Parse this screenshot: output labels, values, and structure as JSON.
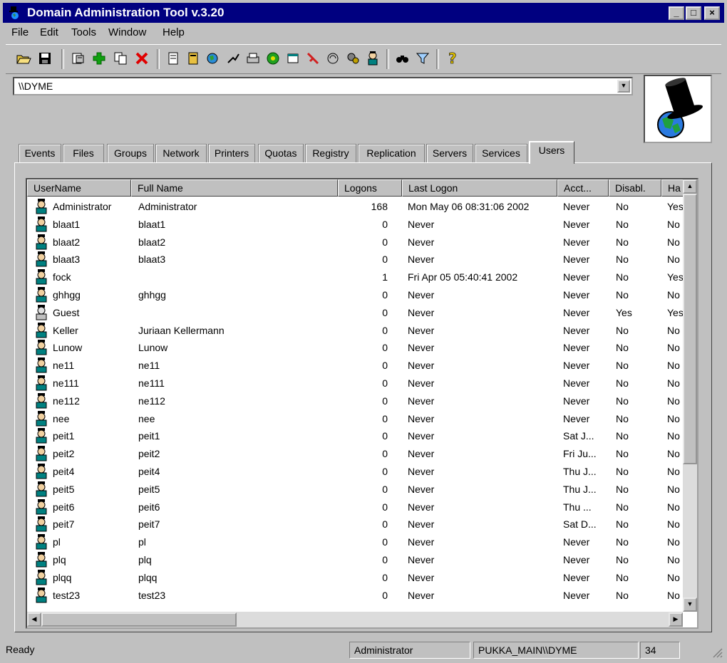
{
  "window": {
    "title": "Domain Administration Tool  v.3.20"
  },
  "menu": [
    "File",
    "Edit",
    "Tools",
    "Window",
    "Help"
  ],
  "address": {
    "value": "\\\\DYME"
  },
  "tabs": [
    "Events",
    "Files",
    "Groups",
    "Network",
    "Printers",
    "Quotas",
    "Registry",
    "Replication",
    "Servers",
    "Services",
    "Users"
  ],
  "active_tab": "Users",
  "columns": [
    "UserName",
    "Full Name",
    "Logons",
    "Last Logon",
    "Acct...",
    "Disabl.",
    "Ha"
  ],
  "users": [
    [
      "Administrator",
      "Administrator",
      "168",
      "Mon May 06 08:31:06 2002",
      "Never",
      "No",
      "Yes"
    ],
    [
      "blaat1",
      "blaat1",
      "0",
      "Never",
      "Never",
      "No",
      "No"
    ],
    [
      "blaat2",
      "blaat2",
      "0",
      "Never",
      "Never",
      "No",
      "No"
    ],
    [
      "blaat3",
      "blaat3",
      "0",
      "Never",
      "Never",
      "No",
      "No"
    ],
    [
      "fock",
      "",
      "1",
      "Fri Apr 05 05:40:41 2002",
      "Never",
      "No",
      "Yes"
    ],
    [
      "ghhgg",
      "ghhgg",
      "0",
      "Never",
      "Never",
      "No",
      "No"
    ],
    [
      "Guest",
      "",
      "0",
      "Never",
      "Never",
      "Yes",
      "Yes"
    ],
    [
      "Keller",
      "Juriaan Kellermann",
      "0",
      "Never",
      "Never",
      "No",
      "No"
    ],
    [
      "Lunow",
      "Lunow",
      "0",
      "Never",
      "Never",
      "No",
      "No"
    ],
    [
      "ne11",
      "ne11",
      "0",
      "Never",
      "Never",
      "No",
      "No"
    ],
    [
      "ne111",
      "ne111",
      "0",
      "Never",
      "Never",
      "No",
      "No"
    ],
    [
      "ne112",
      "ne112",
      "0",
      "Never",
      "Never",
      "No",
      "No"
    ],
    [
      "nee",
      "nee",
      "0",
      "Never",
      "Never",
      "No",
      "No"
    ],
    [
      "peit1",
      "peit1",
      "0",
      "Never",
      "Sat J...",
      "No",
      "No"
    ],
    [
      "peit2",
      "peit2",
      "0",
      "Never",
      "Fri Ju...",
      "No",
      "No"
    ],
    [
      "peit4",
      "peit4",
      "0",
      "Never",
      "Thu J...",
      "No",
      "No"
    ],
    [
      "peit5",
      "peit5",
      "0",
      "Never",
      "Thu J...",
      "No",
      "No"
    ],
    [
      "peit6",
      "peit6",
      "0",
      "Never",
      "Thu ...",
      "No",
      "No"
    ],
    [
      "peit7",
      "peit7",
      "0",
      "Never",
      "Sat D...",
      "No",
      "No"
    ],
    [
      "pl",
      "pl",
      "0",
      "Never",
      "Never",
      "No",
      "No"
    ],
    [
      "plq",
      "plq",
      "0",
      "Never",
      "Never",
      "No",
      "No"
    ],
    [
      "plqq",
      "plqq",
      "0",
      "Never",
      "Never",
      "No",
      "No"
    ],
    [
      "test23",
      "test23",
      "0",
      "Never",
      "Never",
      "No",
      "No"
    ]
  ],
  "status": {
    "text": "Ready",
    "user": "Administrator",
    "domain": "PUKKA_MAIN\\\\DYME",
    "count": "34"
  },
  "colors": {
    "titlebar": "#000080",
    "face": "#c0c0c0",
    "list_bg": "#ffffff"
  },
  "toolbar_icons": [
    "open-icon",
    "save-icon",
    "properties-icon",
    "add-icon",
    "copy-icon",
    "delete-icon",
    "event-log-icon",
    "file-icon",
    "network-icon",
    "share-icon",
    "printer-icon",
    "status-icon",
    "window-icon",
    "move-icon",
    "replicate-icon",
    "services-icon",
    "user-icon",
    "find-icon",
    "filter-icon",
    "help-icon"
  ]
}
